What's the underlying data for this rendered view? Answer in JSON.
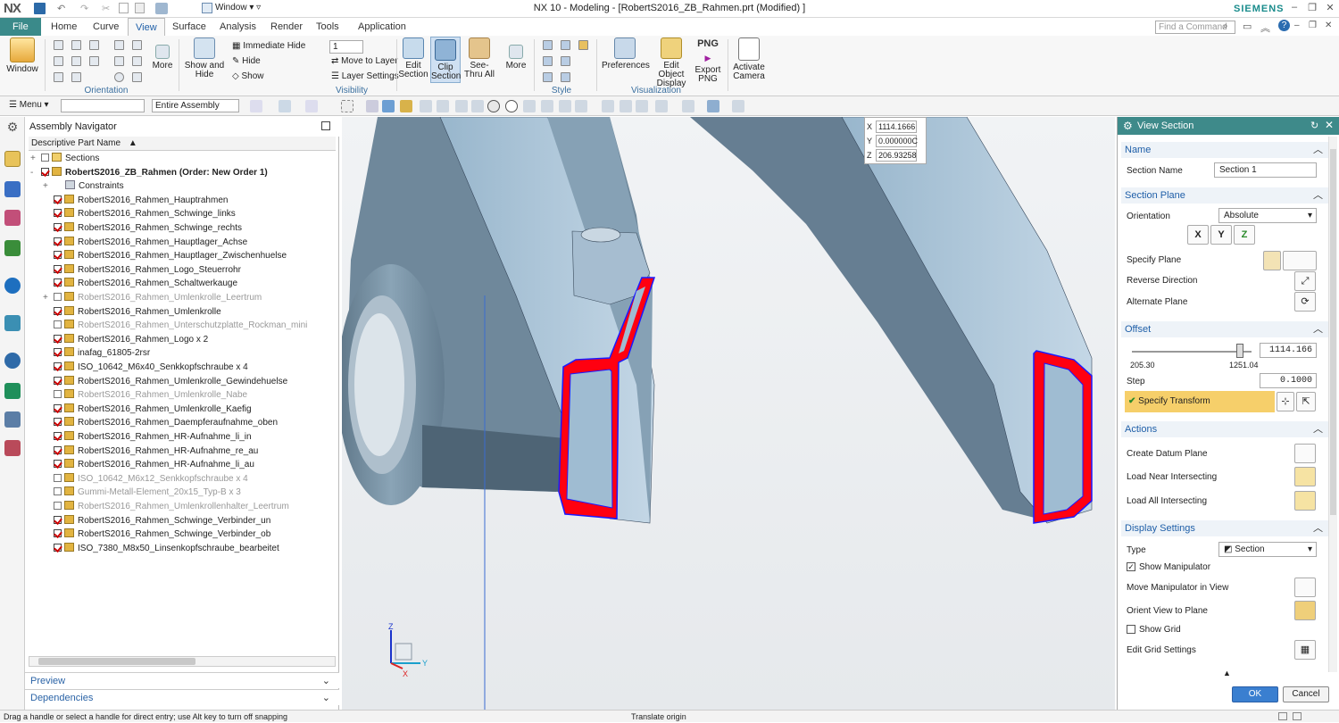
{
  "window": {
    "app_logo": "NX",
    "title": "NX 10 - Modeling - [RobertS2016_ZB_Rahmen.prt (Modified) ]",
    "brand": "SIEMENS",
    "window_menu_label": "Window",
    "search_placeholder": "Find a Command"
  },
  "tabs": [
    "File",
    "Home",
    "Curve",
    "View",
    "Surface",
    "Analysis",
    "Render",
    "Tools",
    "Application"
  ],
  "active_tab": "View",
  "ribbon": {
    "window_label": "Window",
    "more_label": "More",
    "show_hide_label": "Show and Hide",
    "immediate_hide": "Immediate Hide",
    "hide": "Hide",
    "show": "Show",
    "layer_value": "1",
    "move_to_layer": "Move to Layer",
    "layer_settings": "Layer Settings",
    "edit_section": "Edit Section",
    "clip_section": "Clip Section",
    "see_thru_all": "See-Thru All",
    "more2_label": "More",
    "preferences": "Preferences",
    "edit_object_display": "Edit Object Display",
    "export_png": "Export PNG",
    "png_badge": "PNG",
    "activate_camera": "Activate Camera",
    "groups": {
      "orientation": "Orientation",
      "visibility": "Visibility",
      "style": "Style",
      "visualization": "Visualization"
    }
  },
  "toolbar2": {
    "menu_label": "Menu",
    "filter_value": "",
    "scope_value": "Entire Assembly"
  },
  "navigator": {
    "title": "Assembly Navigator",
    "column_header": "Descriptive Part Name",
    "rows": [
      {
        "label": "Sections",
        "level": 1,
        "checked": false,
        "dim": false,
        "expand": "+",
        "folder": true
      },
      {
        "label": "RobertS2016_ZB_Rahmen (Order: New Order 1)",
        "level": 1,
        "checked": true,
        "dim": false,
        "expand": "-",
        "bold": true
      },
      {
        "label": "Constraints",
        "level": 2,
        "checked": null,
        "dim": false,
        "expand": "+"
      },
      {
        "label": "RobertS2016_Rahmen_Hauptrahmen",
        "level": 2,
        "checked": true,
        "dim": false
      },
      {
        "label": "RobertS2016_Rahmen_Schwinge_links",
        "level": 2,
        "checked": true,
        "dim": false
      },
      {
        "label": "RobertS2016_Rahmen_Schwinge_rechts",
        "level": 2,
        "checked": true,
        "dim": false
      },
      {
        "label": "RobertS2016_Rahmen_Hauptlager_Achse",
        "level": 2,
        "checked": true,
        "dim": false
      },
      {
        "label": "RobertS2016_Rahmen_Hauptlager_Zwischenhuelse",
        "level": 2,
        "checked": true,
        "dim": false
      },
      {
        "label": "RobertS2016_Rahmen_Logo_Steuerrohr",
        "level": 2,
        "checked": true,
        "dim": false
      },
      {
        "label": "RobertS2016_Rahmen_Schaltwerkauge",
        "level": 2,
        "checked": true,
        "dim": false
      },
      {
        "label": "RobertS2016_Rahmen_Umlenkrolle_Leertrum",
        "level": 2,
        "checked": false,
        "dim": true,
        "expand": "+"
      },
      {
        "label": "RobertS2016_Rahmen_Umlenkrolle",
        "level": 2,
        "checked": true,
        "dim": false
      },
      {
        "label": "RobertS2016_Rahmen_Unterschutzplatte_Rockman_mini",
        "level": 2,
        "checked": false,
        "dim": true
      },
      {
        "label": "RobertS2016_Rahmen_Logo x 2",
        "level": 2,
        "checked": true,
        "dim": false
      },
      {
        "label": "inafag_61805-2rsr",
        "level": 2,
        "checked": true,
        "dim": false
      },
      {
        "label": "ISO_10642_M6x40_Senkkopfschraube x 4",
        "level": 2,
        "checked": true,
        "dim": false
      },
      {
        "label": "RobertS2016_Rahmen_Umlenkrolle_Gewindehuelse",
        "level": 2,
        "checked": true,
        "dim": false
      },
      {
        "label": "RobertS2016_Rahmen_Umlenkrolle_Nabe",
        "level": 2,
        "checked": false,
        "dim": true
      },
      {
        "label": "RobertS2016_Rahmen_Umlenkrolle_Kaefig",
        "level": 2,
        "checked": true,
        "dim": false
      },
      {
        "label": "RobertS2016_Rahmen_Daempferaufnahme_oben",
        "level": 2,
        "checked": true,
        "dim": false
      },
      {
        "label": "RobertS2016_Rahmen_HR-Aufnahme_li_in",
        "level": 2,
        "checked": true,
        "dim": false
      },
      {
        "label": "RobertS2016_Rahmen_HR-Aufnahme_re_au",
        "level": 2,
        "checked": true,
        "dim": false
      },
      {
        "label": "RobertS2016_Rahmen_HR-Aufnahme_li_au",
        "level": 2,
        "checked": true,
        "dim": false
      },
      {
        "label": "ISO_10642_M6x12_Senkkopfschraube x 4",
        "level": 2,
        "checked": false,
        "dim": true
      },
      {
        "label": "Gummi-Metall-Element_20x15_Typ-B x 3",
        "level": 2,
        "checked": false,
        "dim": true
      },
      {
        "label": "RobertS2016_Rahmen_Umlenkrollenhalter_Leertrum",
        "level": 2,
        "checked": false,
        "dim": true
      },
      {
        "label": "RobertS2016_Rahmen_Schwinge_Verbinder_un",
        "level": 2,
        "checked": true,
        "dim": false
      },
      {
        "label": "RobertS2016_Rahmen_Schwinge_Verbinder_ob",
        "level": 2,
        "checked": true,
        "dim": false
      },
      {
        "label": "ISO_7380_M8x50_Linsenkopfschraube_bearbeitet",
        "level": 2,
        "checked": true,
        "dim": false
      }
    ],
    "preview_label": "Preview",
    "dependencies_label": "Dependencies"
  },
  "coords": {
    "x_label": "X",
    "y_label": "Y",
    "z_label": "Z",
    "x": "1114.1666",
    "y": "0.000000C",
    "z": "206.93258"
  },
  "triad": {
    "x": "X",
    "y": "Y",
    "z": "Z"
  },
  "dialog": {
    "title": "View Section",
    "name_section": "Name",
    "section_name_label": "Section Name",
    "section_name_value": "Section 1",
    "plane_section": "Section Plane",
    "orientation_label": "Orientation",
    "orientation_value": "Absolute",
    "axis_buttons": [
      "X",
      "Y",
      "Z"
    ],
    "specify_plane": "Specify Plane",
    "reverse_direction": "Reverse Direction",
    "alternate_plane": "Alternate Plane",
    "offset_section": "Offset",
    "offset_value": "1114.166",
    "slider_min": "205.30",
    "slider_max": "1251.04",
    "slider_fraction": 0.9,
    "step_label": "Step",
    "step_value": "0.1000",
    "specify_transform": "Specify Transform",
    "actions_section": "Actions",
    "create_datum_plane": "Create Datum Plane",
    "load_near_intersecting": "Load Near Intersecting",
    "load_all_intersecting": "Load All Intersecting",
    "display_section": "Display Settings",
    "type_label": "Type",
    "type_value": "Section",
    "show_manipulator": "Show Manipulator",
    "show_manipulator_checked": true,
    "move_manipulator": "Move Manipulator in View",
    "orient_view": "Orient View to Plane",
    "show_grid": "Show Grid",
    "show_grid_checked": false,
    "edit_grid": "Edit Grid Settings",
    "ok": "OK",
    "cancel": "Cancel"
  },
  "status": {
    "left": "Drag a handle or select a handle for direct entry; use Alt key to turn off snapping",
    "center": "Translate origin"
  },
  "colors": {
    "accent": "#3e8a8a",
    "section_red": "#ff0010",
    "outline_blue": "#1a1aff",
    "part_blue": "#7a98ad",
    "highlight": "#f6cf6a"
  }
}
